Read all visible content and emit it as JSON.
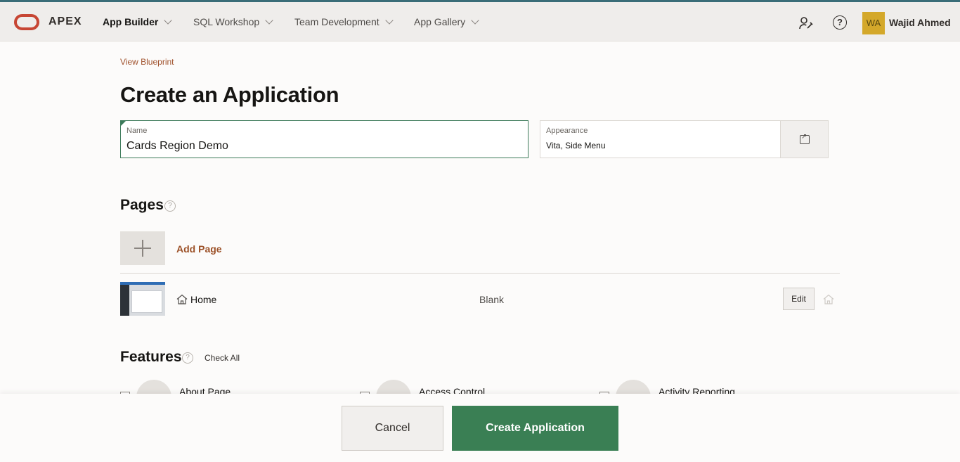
{
  "nav": {
    "brand": "APEX",
    "items": [
      {
        "label": "App Builder"
      },
      {
        "label": "SQL Workshop"
      },
      {
        "label": "Team Development"
      },
      {
        "label": "App Gallery"
      }
    ],
    "user": {
      "initials": "WA",
      "name": "Wajid Ahmed"
    }
  },
  "breadcrumb": {
    "link": "View Blueprint"
  },
  "page": {
    "title": "Create an Application"
  },
  "form": {
    "name": {
      "label": "Name",
      "value": "Cards Region Demo"
    },
    "appearance": {
      "label": "Appearance",
      "value": "Vita, Side Menu"
    }
  },
  "pages": {
    "title": "Pages",
    "help": "?",
    "add_label": "Add Page",
    "rows": [
      {
        "name": "Home",
        "type": "Blank",
        "edit_label": "Edit"
      }
    ]
  },
  "features": {
    "title": "Features",
    "help": "?",
    "check_all": "Check All",
    "items": [
      {
        "label": "About Page"
      },
      {
        "label": "Access Control"
      },
      {
        "label": "Activity Reporting"
      }
    ]
  },
  "footer": {
    "cancel": "Cancel",
    "create": "Create Application"
  },
  "colors": {
    "accent": "#3a7f54",
    "brand": "#c74634",
    "link": "#a0522d"
  }
}
